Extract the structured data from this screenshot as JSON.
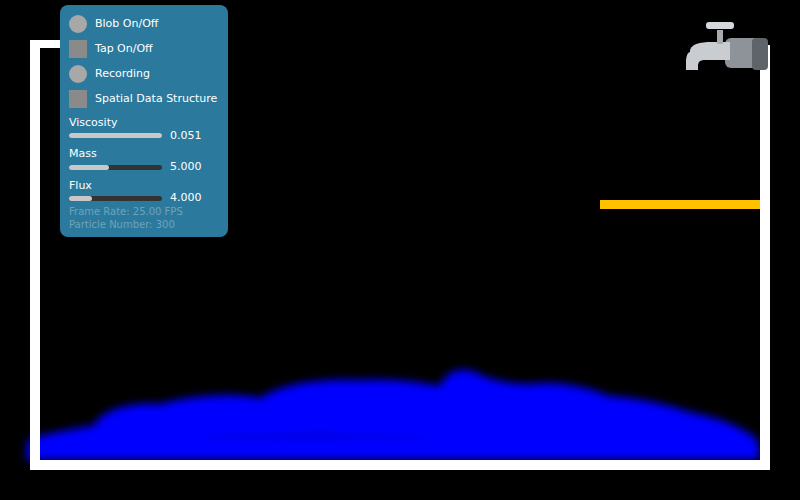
{
  "controls": [
    {
      "label": "Blob On/Off",
      "kind": "radio",
      "on": false
    },
    {
      "label": "Tap On/Off",
      "kind": "check",
      "on": false
    },
    {
      "label": "Recording",
      "kind": "radio",
      "on": false
    },
    {
      "label": "Spatial Data Structure",
      "kind": "check",
      "on": false
    }
  ],
  "sliders": [
    {
      "label": "Viscosity",
      "level": 1.0,
      "reading": "0.051"
    },
    {
      "label": "Mass",
      "level": 0.43,
      "reading": "5.000"
    },
    {
      "label": "Flux",
      "level": 0.25,
      "reading": "4.000"
    }
  ],
  "stats": [
    "Frame Rate: 25.00 FPS",
    "Particle Number: 300"
  ]
}
